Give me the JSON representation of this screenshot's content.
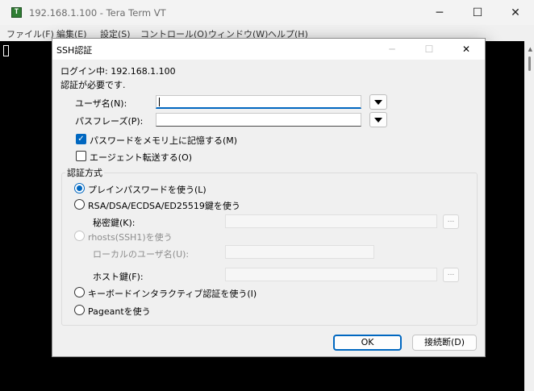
{
  "window": {
    "title": "192.168.1.100 - Tera Term VT",
    "app_icon_glyph": "T",
    "minimize_glyph": "─",
    "maximize_glyph": "☐",
    "close_glyph": "✕"
  },
  "menubar": {
    "items": [
      "ファイル(F)",
      "編集(E)",
      "設定(S)",
      "コントロール(O)",
      "ウィンドウ(W)",
      "ヘルプ(H)"
    ]
  },
  "dialog": {
    "title": "SSH認証",
    "minimize_glyph": "─",
    "maximize_glyph": "☐",
    "close_glyph": "✕",
    "login_line": "ログイン中: 192.168.1.100",
    "auth_required": "認証が必要です.",
    "username_label": "ユーザ名(N):",
    "username_value": "",
    "passphrase_label": "パスフレーズ(P):",
    "passphrase_value": "",
    "remember_password_label": "パスワードをメモリ上に記憶する(M)",
    "remember_password_checked": true,
    "check_glyph": "✓",
    "agent_forward_label": "エージェント転送する(O)",
    "agent_forward_checked": false,
    "auth_method_group_label": "認証方式",
    "auth_methods": {
      "plain_password": "プレインパスワードを使う(L)",
      "rsa_key": "RSA/DSA/ECDSA/ED25519鍵を使う",
      "private_key_label": "秘密鍵(K):",
      "rhosts": "rhosts(SSH1)を使う",
      "local_user_label": "ローカルのユーザ名(U):",
      "host_key_label": "ホスト鍵(F):",
      "keyboard_interactive": "キーボードインタラクティブ認証を使う(I)",
      "pageant": "Pageantを使う"
    },
    "selected_method": "plain_password",
    "browse_label": "...",
    "ok_label": "OK",
    "disconnect_label": "接続断(D)"
  },
  "colors": {
    "accent": "#0067c0",
    "terminal_bg": "#000000"
  }
}
